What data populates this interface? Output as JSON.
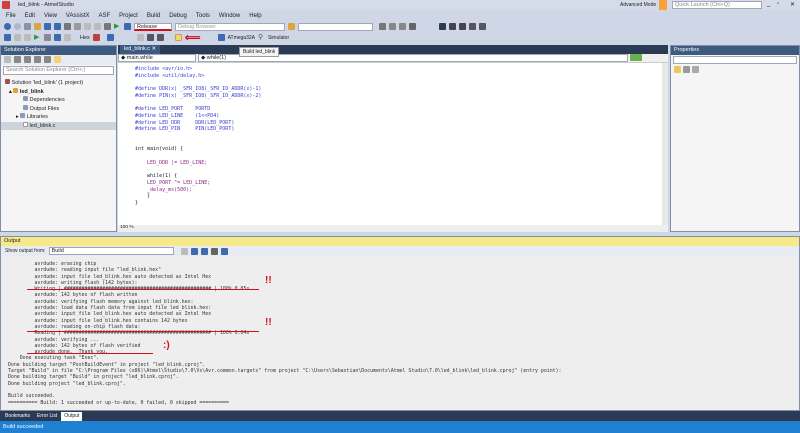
{
  "window": {
    "title": "led_blink - AtmelStudio",
    "advanced_mode": "Advanced Mode",
    "quick_launch_placeholder": "Quick Launch (Ctrl+Q)"
  },
  "menu": [
    "File",
    "Edit",
    "View",
    "VAssistX",
    "ASF",
    "Project",
    "Build",
    "Debug",
    "Tools",
    "Window",
    "Help"
  ],
  "toolbar": {
    "configuration": "Release",
    "debug_browser": "Debug Browser",
    "hex_label": "Hex",
    "device": "ATmega32A",
    "tool": "Simulator",
    "tooltip": "Build led_blink"
  },
  "solution_explorer": {
    "title": "Solution Explorer",
    "search_placeholder": "Search Solution Explorer (Ctrl+;)",
    "items": [
      {
        "label": "Solution 'led_blink' (1 project)",
        "level": 0
      },
      {
        "label": "led_blink",
        "level": 1
      },
      {
        "label": "Dependencies",
        "level": 2
      },
      {
        "label": "Output Files",
        "level": 2
      },
      {
        "label": "Libraries",
        "level": 2
      },
      {
        "label": "led_blink.c",
        "level": 2
      }
    ]
  },
  "editor": {
    "tab": "led_blink.c",
    "scope": "main.while",
    "member": "while(1)",
    "zoom": "100 %",
    "lines": [
      "#include <avr/io.h>",
      "#include <util/delay.h>",
      "",
      "#define DDR(x) _SFR_IO8(_SFR_IO_ADDR(x)-1)",
      "#define PIN(x) _SFR_IO8(_SFR_IO_ADDR(x)-2)",
      "",
      "#define LED_PORT    PORTD",
      "#define LED_LINE    (1<<PD4)",
      "#define LED_DDR     DDR(LED_PORT)",
      "#define LED_PIN     PIN(LED_PORT)",
      "",
      "",
      "int main(void) {",
      "",
      "    LED_DDR |= LED_LINE;",
      "",
      "    while(1) {",
      "    LED_PORT ^= LED_LINE;",
      "    _delay_ms(500);",
      "    }",
      "}"
    ]
  },
  "properties": {
    "title": "Properties"
  },
  "output": {
    "title": "Output",
    "show_from_label": "Show output from:",
    "source": "Build",
    "lines": [
      "          avrdude: erasing chip",
      "          avrdude: reading input file \"led_blink.hex\"",
      "          avrdude: input file led_blink.hex auto detected as Intel Hex",
      "          avrdude: writing flash (142 bytes):",
      "          Writing | ################################################## | 100% 0.05s",
      "          avrdude: 142 bytes of flash written",
      "          avrdude: verifying flash memory against led_blink.hex:",
      "          avrdude: load data flash data from input file led_blink.hex:",
      "          avrdude: input file led_blink.hex auto detected as Intel Hex",
      "          avrdude: input file led_blink.hex contains 142 bytes",
      "          avrdude: reading on-chip flash data:",
      "          Reading | ################################################## | 100% 0.04s",
      "          avrdude: verifying ...",
      "          avrdude: 142 bytes of flash verified",
      "          avrdude done.  Thank you.",
      "     Done executing task \"Exec\".",
      " Done building target \"PostBuildEvent\" in project \"led_blink.cproj\".",
      " Target \"Build\" in file \"C:\\Program Files (x86)\\Atmel\\Studio\\7.0\\Vs\\Avr.common.targets\" from project \"C:\\Users\\Sebastian\\Documents\\Atmel Studio\\7.0\\led_blink\\led_blink.cproj\" (entry point):",
      " Done building target \"Build\" in project \"led_blink.cproj\".",
      " Done building project \"led_blink.cproj\".",
      "",
      " Build succeeded.",
      " ========== Build: 1 succeeded or up-to-date, 0 failed, 0 skipped =========="
    ],
    "annotations": [
      "!!",
      "!!",
      ":)"
    ]
  },
  "bottom_tabs": [
    "Bookmarks",
    "Error List",
    "Output"
  ],
  "status": "Build succeeded",
  "colors": {
    "accent": "#1f7fd0",
    "annotation": "#d0101a",
    "panel_header": "#3d5a80"
  }
}
